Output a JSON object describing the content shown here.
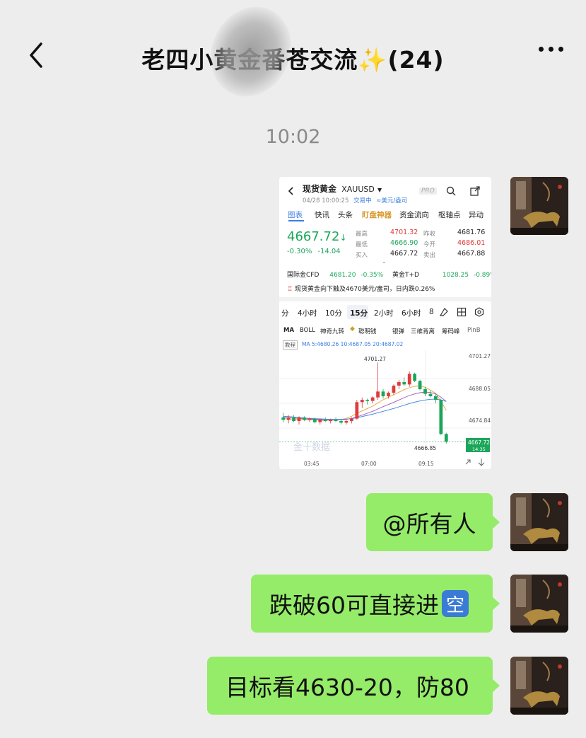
{
  "header": {
    "title": "老四小黄金番苍交流✨(24)"
  },
  "timestamp": "10:02",
  "image_message": {
    "title": "现货黄金",
    "symbol": "XAUUSD",
    "datetime": "04/28 10:00:25",
    "trade_status": "交易中",
    "unit": "≈美元/盎司",
    "pro": "PRO",
    "tabs": [
      "图表",
      "快讯",
      "头条",
      "盯盘神器",
      "资金流向",
      "枢轴点",
      "异动"
    ],
    "price": "4667.72",
    "change_pct": "-0.30%",
    "change_abs": "-14.04",
    "stats": {
      "high_label": "最高",
      "high": "4701.32",
      "low_label": "最低",
      "low": "4666.90",
      "buy_label": "买入",
      "buy": "4667.72",
      "prev_label": "昨收",
      "prev": "4681.76",
      "open_label": "今开",
      "open": "4686.01",
      "sell_label": "卖出",
      "sell": "4667.88"
    },
    "related_1_name": "国际金CFD",
    "related_1_price": "4681.20",
    "related_1_pct": "-0.35%",
    "related_2_name": "黄金T+D",
    "related_2_price": "1028.25",
    "related_2_pct": "-0.89%",
    "alert": "现货黄金向下触及4670美元/盎司，日内跌0.26%",
    "intervals": [
      "分",
      "4小时",
      "10分",
      "15分",
      "2小时",
      "6小时",
      "8"
    ],
    "indicators": [
      "MA",
      "BOLL",
      "神奇九转",
      "聪明钱",
      "银弹",
      "三维背离",
      "筹码峰",
      "PinB"
    ],
    "ma_tag": "教程",
    "ma_line": "MA 5:4680.26  10:4687.05  20:4687.02",
    "price_high_label": "4701.27",
    "price_low_label": "4666.85",
    "y_ticks": [
      "4701.27",
      "4688.05",
      "4674.84"
    ],
    "current_price_tag": "4667.72",
    "current_time_tag": "14:35",
    "x_ticks": [
      "03:45",
      "07:00",
      "09:15"
    ],
    "watermark": "金十数据"
  },
  "chart_data": {
    "type": "candlestick",
    "x_ticks": [
      "03:45",
      "07:00",
      "09:15"
    ],
    "ylim": [
      4663,
      4705
    ],
    "candles": [
      {
        "o": 4678.0,
        "h": 4680.0,
        "l": 4676.0,
        "c": 4677.0
      },
      {
        "o": 4677.0,
        "h": 4679.0,
        "l": 4675.5,
        "c": 4678.0
      },
      {
        "o": 4678.0,
        "h": 4679.0,
        "l": 4676.0,
        "c": 4676.5
      },
      {
        "o": 4676.5,
        "h": 4678.5,
        "l": 4675.0,
        "c": 4678.0
      },
      {
        "o": 4678.0,
        "h": 4678.5,
        "l": 4676.5,
        "c": 4677.0
      },
      {
        "o": 4677.0,
        "h": 4678.0,
        "l": 4676.0,
        "c": 4677.5
      },
      {
        "o": 4677.5,
        "h": 4678.0,
        "l": 4675.5,
        "c": 4676.0
      },
      {
        "o": 4676.0,
        "h": 4677.5,
        "l": 4675.0,
        "c": 4677.0
      },
      {
        "o": 4677.0,
        "h": 4678.0,
        "l": 4676.0,
        "c": 4676.5
      },
      {
        "o": 4676.5,
        "h": 4677.5,
        "l": 4675.5,
        "c": 4677.0
      },
      {
        "o": 4677.0,
        "h": 4678.0,
        "l": 4676.0,
        "c": 4676.5
      },
      {
        "o": 4676.5,
        "h": 4677.0,
        "l": 4675.0,
        "c": 4675.8
      },
      {
        "o": 4675.8,
        "h": 4677.0,
        "l": 4675.0,
        "c": 4676.5
      },
      {
        "o": 4676.5,
        "h": 4678.0,
        "l": 4675.5,
        "c": 4677.5
      },
      {
        "o": 4677.5,
        "h": 4685.5,
        "l": 4677.0,
        "c": 4684.5
      },
      {
        "o": 4684.5,
        "h": 4686.5,
        "l": 4682.0,
        "c": 4685.5
      },
      {
        "o": 4685.5,
        "h": 4686.0,
        "l": 4683.5,
        "c": 4685.0
      },
      {
        "o": 4685.0,
        "h": 4687.0,
        "l": 4684.0,
        "c": 4686.5
      },
      {
        "o": 4686.5,
        "h": 4701.3,
        "l": 4685.5,
        "c": 4689.0
      },
      {
        "o": 4689.0,
        "h": 4690.0,
        "l": 4686.0,
        "c": 4687.0
      },
      {
        "o": 4687.0,
        "h": 4689.0,
        "l": 4686.0,
        "c": 4688.5
      },
      {
        "o": 4688.5,
        "h": 4692.0,
        "l": 4687.5,
        "c": 4691.5
      },
      {
        "o": 4691.5,
        "h": 4694.0,
        "l": 4690.0,
        "c": 4693.0
      },
      {
        "o": 4693.0,
        "h": 4695.0,
        "l": 4691.5,
        "c": 4692.0
      },
      {
        "o": 4692.0,
        "h": 4697.5,
        "l": 4691.0,
        "c": 4696.5
      },
      {
        "o": 4696.5,
        "h": 4697.0,
        "l": 4693.0,
        "c": 4693.5
      },
      {
        "o": 4693.5,
        "h": 4694.0,
        "l": 4689.5,
        "c": 4690.0
      },
      {
        "o": 4690.0,
        "h": 4691.0,
        "l": 4687.0,
        "c": 4688.0
      },
      {
        "o": 4688.0,
        "h": 4689.5,
        "l": 4686.5,
        "c": 4687.0
      },
      {
        "o": 4687.0,
        "h": 4688.0,
        "l": 4684.0,
        "c": 4685.5
      },
      {
        "o": 4685.5,
        "h": 4686.0,
        "l": 4670.5,
        "c": 4671.0
      },
      {
        "o": 4671.0,
        "h": 4671.5,
        "l": 4666.9,
        "c": 4667.7
      }
    ],
    "ma": {
      "ma5": [
        4677.5,
        4677.4,
        4677.3,
        4677.1,
        4677.0,
        4677.0,
        4676.9,
        4676.8,
        4676.8,
        4676.9,
        4677.0,
        4677.2,
        4677.6,
        4678.5,
        4679.8,
        4680.8,
        4681.8,
        4682.8,
        4684.2,
        4685.5,
        4686.6,
        4687.6,
        4688.7,
        4689.8,
        4690.6,
        4691.2,
        4691.4,
        4690.8,
        4689.6,
        4688.2,
        4684.8,
        4681.0
      ],
      "ma10": [
        4678.0,
        4677.9,
        4677.8,
        4677.6,
        4677.4,
        4677.3,
        4677.2,
        4677.1,
        4677.0,
        4676.9,
        4676.9,
        4677.0,
        4677.2,
        4677.6,
        4678.2,
        4679.0,
        4679.8,
        4680.6,
        4681.6,
        4682.6,
        4683.5,
        4684.4,
        4685.4,
        4686.4,
        4687.3,
        4688.0,
        4688.5,
        4688.8,
        4688.6,
        4688.0,
        4686.6,
        4684.8
      ],
      "ma20": [
        4678.5,
        4678.4,
        4678.2,
        4678.0,
        4677.8,
        4677.6,
        4677.5,
        4677.4,
        4677.3,
        4677.2,
        4677.2,
        4677.2,
        4677.3,
        4677.5,
        4677.9,
        4678.4,
        4678.9,
        4679.4,
        4680.0,
        4680.6,
        4681.2,
        4681.8,
        4682.5,
        4683.2,
        4683.9,
        4684.5,
        4685.0,
        4685.4,
        4685.7,
        4685.8,
        4685.4,
        4684.8
      ]
    }
  },
  "messages": [
    {
      "text": "@所有人"
    },
    {
      "text": "跌破60可直接进",
      "badge": "空"
    },
    {
      "text": "目标看4630-20，防80"
    }
  ],
  "colors": {
    "bubble": "#95ec69",
    "up": "#e03b3b",
    "down": "#1ba65a",
    "background": "#ededed"
  }
}
